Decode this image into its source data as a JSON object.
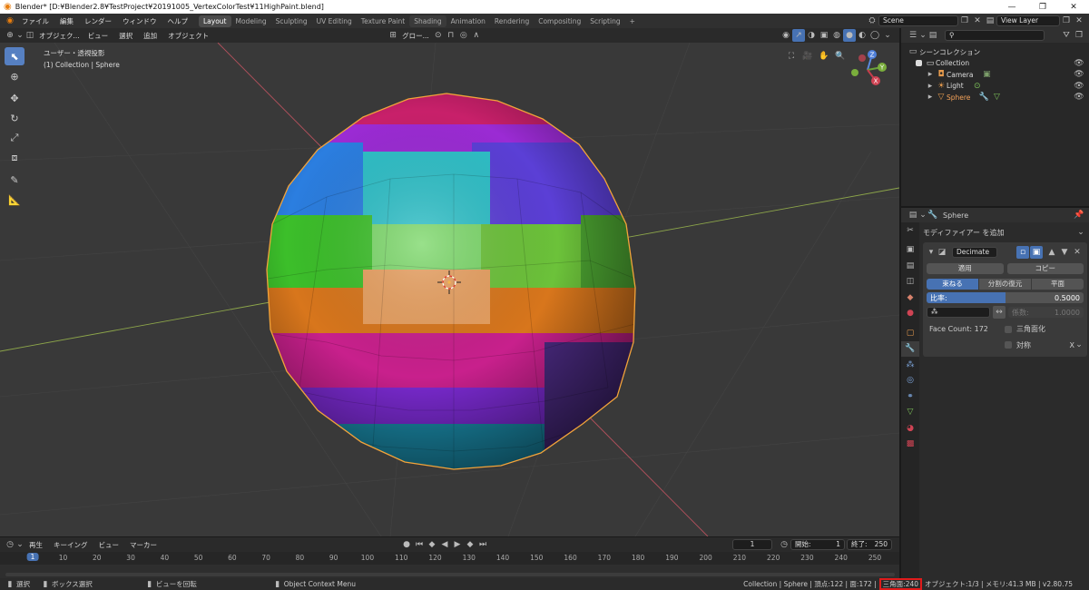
{
  "titlebar": {
    "title": "Blender* [D:¥Blender2.8¥TestProject¥20191005_VertexColorTest¥11HighPaint.blend]"
  },
  "menu": [
    "ファイル",
    "編集",
    "レンダー",
    "ウィンドウ",
    "ヘルプ"
  ],
  "workspaces": [
    "Layout",
    "Modeling",
    "Sculpting",
    "UV Editing",
    "Texture Paint",
    "Shading",
    "Animation",
    "Rendering",
    "Compositing",
    "Scripting"
  ],
  "workspace_active": "Layout",
  "workspace_add": "+",
  "scene": {
    "label": "Scene",
    "view_layer": "View Layer"
  },
  "viewport_header": {
    "mode": "オブジェク...",
    "menus": [
      "ビュー",
      "選択",
      "追加",
      "オブジェクト"
    ],
    "transform": "グロー..."
  },
  "viewport": {
    "view_name": "ユーザー・透視投影",
    "collection_info": "(1) Collection | Sphere"
  },
  "gizmo": {
    "z": "Z",
    "y": "Y",
    "x": "X"
  },
  "timeline": {
    "menus": [
      "再生",
      "キーイング",
      "ビュー",
      "マーカー"
    ],
    "current_frame": "1",
    "start_label": "開始:",
    "start": "1",
    "end_label": "終了:",
    "end": "250",
    "ticks": [
      "1",
      "10",
      "20",
      "30",
      "40",
      "50",
      "60",
      "70",
      "80",
      "90",
      "100",
      "110",
      "120",
      "130",
      "140",
      "150",
      "160",
      "170",
      "180",
      "190",
      "200",
      "210",
      "220",
      "230",
      "240",
      "250"
    ]
  },
  "outliner": {
    "root": "シーンコレクション",
    "collection": "Collection",
    "items": [
      "Camera",
      "Light",
      "Sphere"
    ]
  },
  "properties": {
    "object_name": "Sphere",
    "add_modifier": "モディファイアー を追加",
    "modifier_name": "Decimate",
    "apply": "適用",
    "copy": "コピー",
    "modes": [
      "束ねる",
      "分割の復元",
      "平面"
    ],
    "ratio_label": "比率:",
    "ratio_value": "0.5000",
    "ratio": 0.5,
    "factor_label": "係数:",
    "factor_value": "1.0000",
    "face_count": "Face Count: 172",
    "triangulate": "三角面化",
    "symmetry": "対称",
    "axis": "X"
  },
  "statusbar": {
    "select": "選択",
    "box_select": "ボックス選択",
    "rotate_view": "ビューを回転",
    "context_menu": "Object Context Menu",
    "stats_prefix": "Collection | Sphere | 頂点:122 | 面:172 |",
    "triangles": "三角面:240",
    "stats_suffix": "オブジェクト:1/3 | メモリ:41.3 MB | v2.80.75"
  },
  "colors": {
    "accent": "#4772b3",
    "selection_outline": "#f2a33a",
    "status_highlight": "#e01b1b"
  }
}
